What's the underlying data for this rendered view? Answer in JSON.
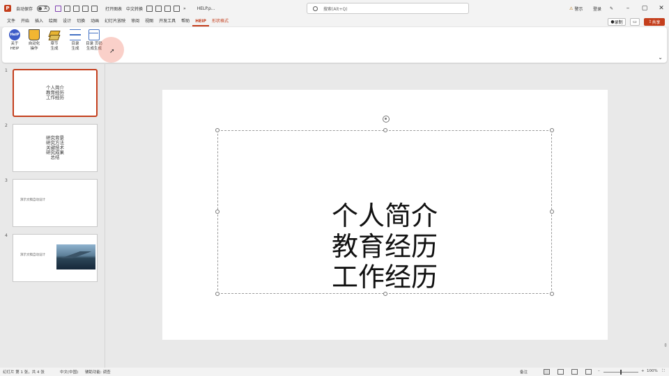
{
  "titlebar": {
    "autosave_label": "自动保存",
    "autosave_state": "关",
    "undo_label": "撤销",
    "qa_text_1": "打开图表",
    "qa_text_2": "中文转换",
    "filename": "HELP.p...",
    "search_placeholder": "搜索(Alt+Q)",
    "warning_label": "警示",
    "account_label": "登录"
  },
  "menu": {
    "tabs": [
      "文件",
      "开始",
      "插入",
      "绘图",
      "设计",
      "切换",
      "动画",
      "幻灯片放映",
      "审阅",
      "视图",
      "开发工具",
      "帮助",
      "HEIP",
      "形状格式"
    ],
    "active_index": 12,
    "context_index": 13,
    "record_label": "录制",
    "share_label": "共享"
  },
  "ribbon": {
    "buttons": [
      {
        "label": "关于\nHEIP"
      },
      {
        "label": "自动化\n操作"
      },
      {
        "label": "章节\n生成"
      },
      {
        "label": "目录\n生成"
      },
      {
        "label": "目录 页码\n生成生成"
      }
    ]
  },
  "thumbnails": [
    {
      "num": "1",
      "text": "个人简介\n教育经历\n工作经历"
    },
    {
      "num": "2",
      "text": "研究背景\n研究方法\n关键技术\n研究成果\n总结"
    },
    {
      "num": "3",
      "small_text": "演示文稿自动设计"
    },
    {
      "num": "4",
      "small_text": "演示文稿自动设计"
    }
  ],
  "slide": {
    "lines": "个人简介\n教育经历\n工作经历"
  },
  "status": {
    "slide_info": "幻灯片 第 1 张，共 4 张",
    "language": "中文(中国)",
    "accessibility": "辅助功能: 调查",
    "notes_label": "备注",
    "zoom": "100%"
  },
  "colors": {
    "accent": "#c43e1c",
    "selection": "#c43e1c"
  }
}
